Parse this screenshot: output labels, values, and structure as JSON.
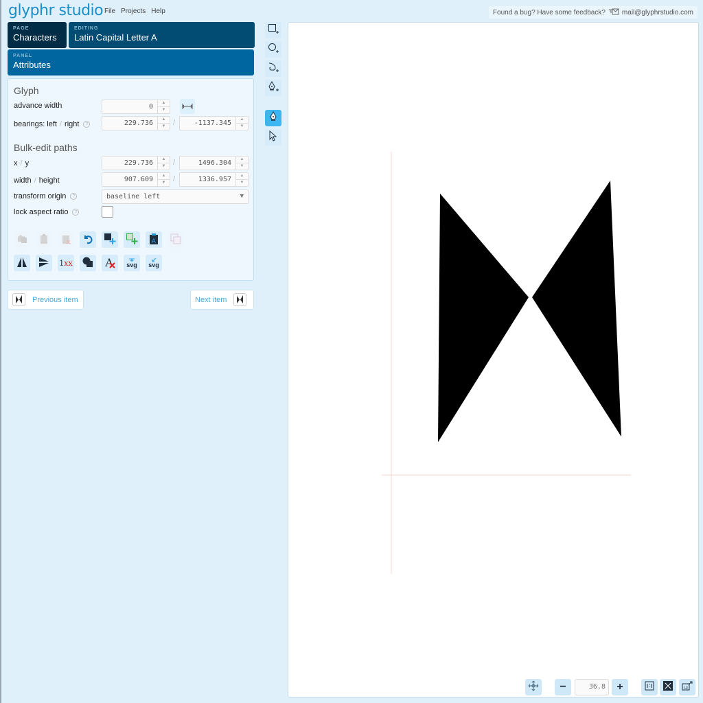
{
  "app": {
    "logo": "glyphr studio",
    "menu": [
      "File",
      "Projects",
      "Help"
    ],
    "feedback_text": "Found a bug? Have some feedback?",
    "feedback_email": "mail@glyphrstudio.com"
  },
  "nav": {
    "page_label": "PAGE",
    "page_value": "Characters",
    "editing_label": "EDITING",
    "editing_value": "Latin Capital Letter A",
    "panel_label": "PANEL",
    "panel_value": "Attributes"
  },
  "glyph": {
    "title": "Glyph",
    "advance_width_label": "advance width",
    "advance_width": "0",
    "bearings_label_left": "bearings: left",
    "bearings_label_right": "right",
    "bearing_left": "229.736",
    "bearing_right": "-1137.345"
  },
  "bulk": {
    "title": "Bulk-edit paths",
    "xy_label_x": "x",
    "xy_label_y": "y",
    "x": "229.736",
    "y": "1496.304",
    "wh_label_w": "width",
    "wh_label_h": "height",
    "width": "907.609",
    "height": "1336.957",
    "transform_origin_label": "transform origin",
    "transform_origin": "baseline left",
    "lock_aspect_label": "lock aspect ratio",
    "lock_aspect": false
  },
  "actions": {
    "row1": [
      "copy",
      "paste",
      "clear-paste",
      "undo",
      "add-shape",
      "add-component",
      "glyph-link",
      "copy-glyph"
    ],
    "row2": [
      "flip-horizontal",
      "flip-vertical",
      "round-values",
      "combine",
      "clear-glyph",
      "import-svg",
      "export-svg"
    ],
    "lxx_label": "1xx",
    "svg_label": "svg"
  },
  "item_nav": {
    "previous": "Previous item",
    "next": "Next item"
  },
  "tools": [
    "new-rectangle",
    "new-oval",
    "new-path",
    "pen-add",
    "pen",
    "pointer"
  ],
  "zoom": {
    "value": "36.8",
    "minus": "−",
    "plus": "+"
  }
}
